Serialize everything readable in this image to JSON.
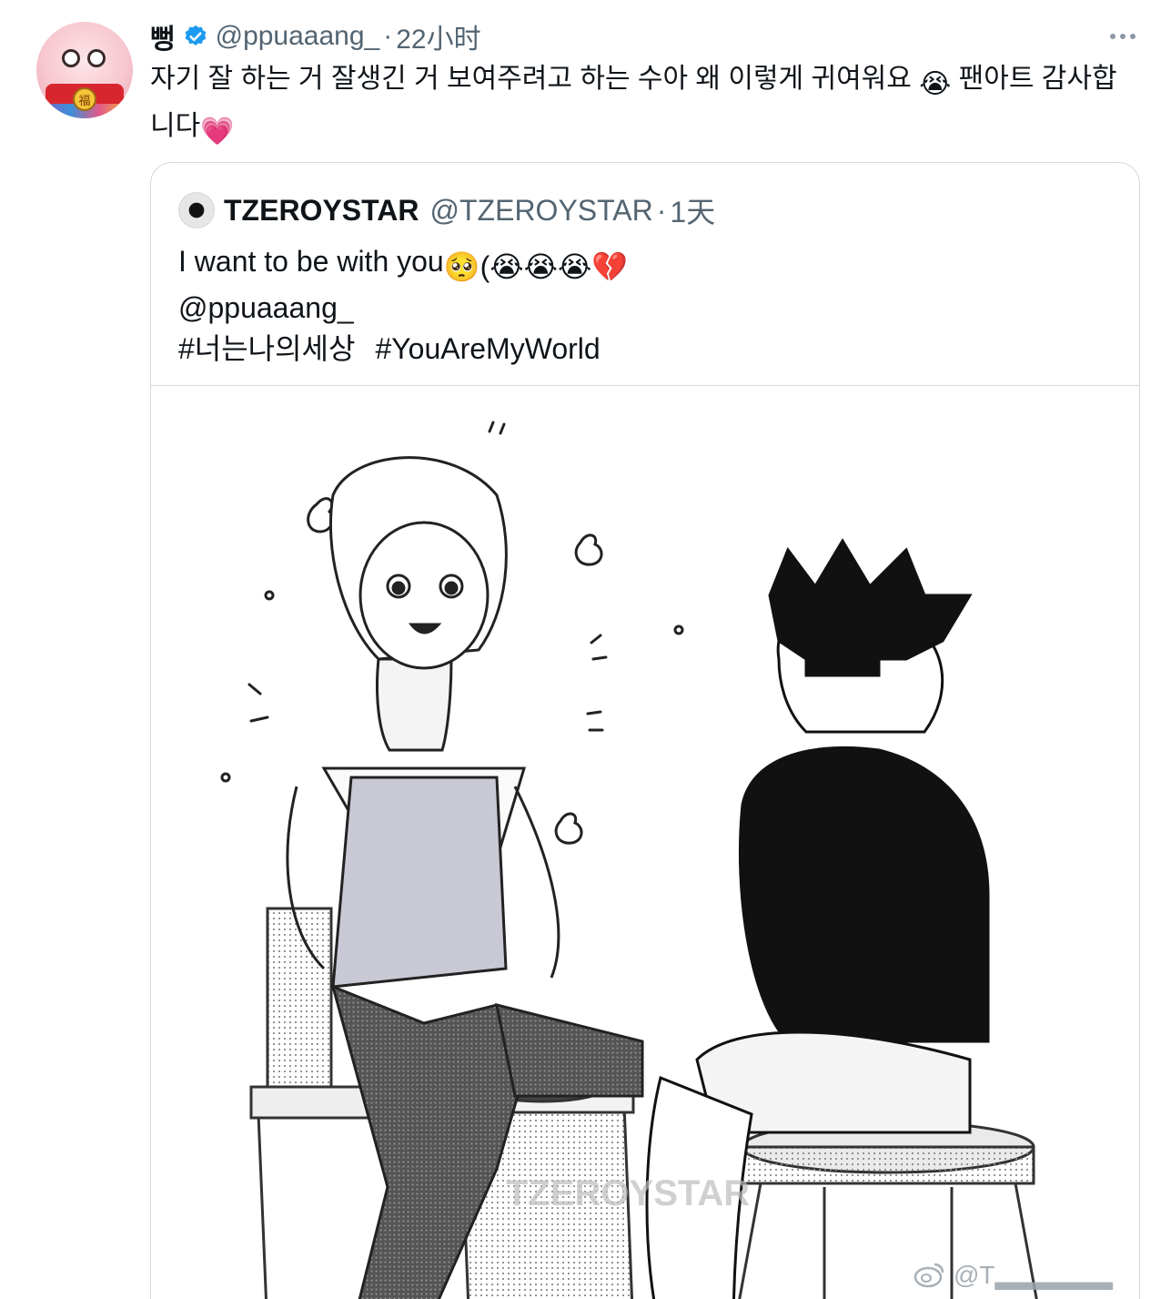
{
  "tweet": {
    "display_name": "뻥",
    "handle": "@ppuaaang_",
    "separator": "·",
    "time": "22小时",
    "text": "자기 잘 하는 거 잘생긴 거 보여주려고 하는 수아 왜 이렇게 귀여워요 ",
    "text_emoji": "😭",
    "text_after": " 팬아트 감사합니다",
    "text_end_emoji": "💗",
    "avatar_coin": "福"
  },
  "quote": {
    "display_name": "TZEROYSTAR",
    "handle": "@TZEROYSTAR",
    "separator": "·",
    "time": "1天",
    "line1": "I want to be with you",
    "line1_emoji": "🥺(😭😭😭💔",
    "mention": "@ppuaaang_",
    "hashtag1": "#너는나의세상",
    "hashtag2": "#YouAreMyWorld",
    "image_watermark": "TZEROYSTAR"
  },
  "watermark": {
    "text": "@T▂▂▂▂▂▂"
  },
  "colors": {
    "verified_blue": "#1d9bf0",
    "secondary_text": "#536471",
    "border": "#cfd9de"
  },
  "icons": {
    "verified": "verified-badge-icon",
    "more": "more-options-icon",
    "weibo": "weibo-logo-icon"
  }
}
